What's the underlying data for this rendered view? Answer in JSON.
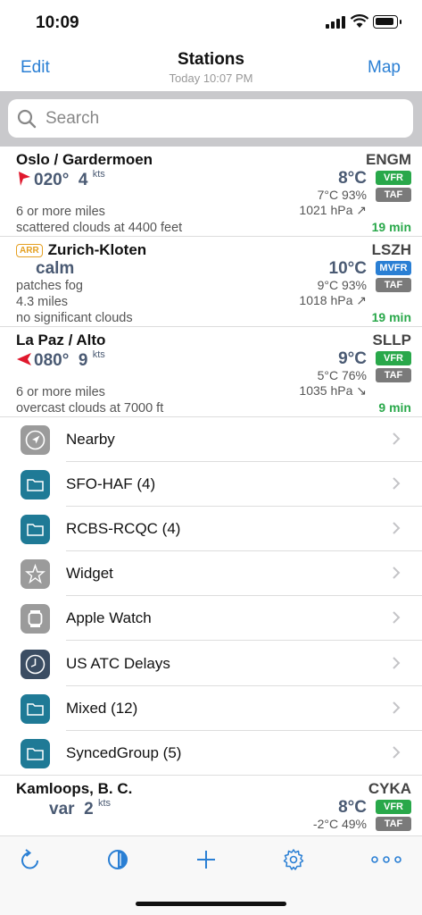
{
  "status_bar": {
    "time": "10:09"
  },
  "nav": {
    "edit": "Edit",
    "title": "Stations",
    "subtitle": "Today 10:07 PM",
    "map": "Map"
  },
  "search": {
    "placeholder": "Search"
  },
  "stations": [
    {
      "name": "Oslo / Gardermoen",
      "arr_badge": "",
      "code": "ENGM",
      "wind_dir": "020°",
      "wind_speed": "4",
      "wind_unit": "kts",
      "temp": "8°C",
      "category": "VFR",
      "taf": "TAF",
      "temp_dew_hum": "7°C 93%",
      "pressure": "1021 hPa ↗",
      "weather": "",
      "visibility": "6 or more miles",
      "clouds": "scattered clouds at 4400 feet",
      "age": "19 min"
    },
    {
      "name": "Zurich-Kloten",
      "arr_badge": "ARR",
      "code": "LSZH",
      "wind_text": "calm",
      "temp": "10°C",
      "category": "MVFR",
      "taf": "TAF",
      "temp_dew_hum": "9°C 93%",
      "pressure": "1018 hPa ↗",
      "weather": "patches fog",
      "visibility": "4.3 miles",
      "clouds": "no significant clouds",
      "age": "19 min"
    },
    {
      "name": "La Paz / Alto",
      "arr_badge": "",
      "code": "SLLP",
      "wind_dir": "080°",
      "wind_speed": "9",
      "wind_unit": "kts",
      "temp": "9°C",
      "category": "VFR",
      "taf": "TAF",
      "temp_dew_hum": "5°C 76%",
      "pressure": "1035 hPa ↘",
      "weather": "",
      "visibility": "6 or more miles",
      "clouds": "overcast clouds at 7000 ft",
      "age": "9 min"
    },
    {
      "name": "Kamloops, B. C.",
      "arr_badge": "",
      "code": "CYKA",
      "wind_text": "var",
      "wind_speed": "2",
      "wind_unit": "kts",
      "temp": "8°C",
      "category": "VFR",
      "taf": "TAF",
      "temp_dew_hum": "-2°C 49%"
    }
  ],
  "groups": [
    {
      "label": "Nearby",
      "icon": "location-arrow-icon"
    },
    {
      "label": "SFO-HAF (4)",
      "icon": "folder-icon"
    },
    {
      "label": "RCBS-RCQC (4)",
      "icon": "folder-icon"
    },
    {
      "label": "Widget",
      "icon": "star-icon"
    },
    {
      "label": "Apple Watch",
      "icon": "watch-icon"
    },
    {
      "label": "US ATC Delays",
      "icon": "clock-icon"
    },
    {
      "label": "Mixed (12)",
      "icon": "folder-icon"
    },
    {
      "label": "SyncedGroup (5)",
      "icon": "folder-icon"
    }
  ],
  "tabbar": [
    "refresh-icon",
    "contrast-icon",
    "add-icon",
    "settings-icon",
    "more-icon"
  ],
  "colors": {
    "accent": "#2a7fd4",
    "vfr": "#29a84a",
    "mvfr": "#2a7fd4",
    "taf": "#7a7a7a",
    "wind_arrow": "#e0182d",
    "arr_badge": "#e5a022"
  }
}
